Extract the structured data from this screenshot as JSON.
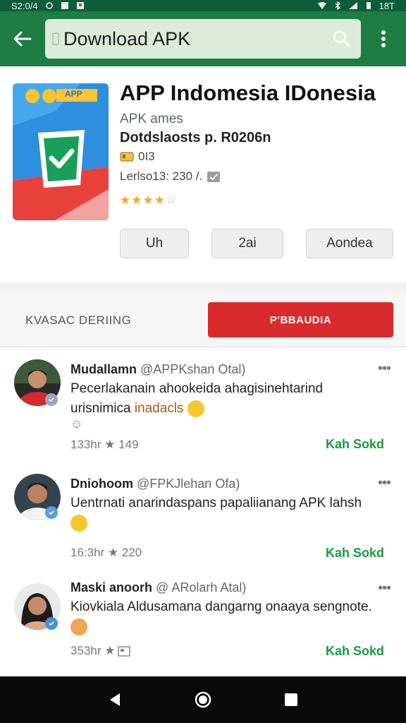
{
  "status_bar": {
    "time": "S2:0/4",
    "battery_text": "18T"
  },
  "search": {
    "placeholder": "Download APK"
  },
  "app": {
    "title": "APP Indomesia IDonesia",
    "category": "APK ames",
    "developer": "Dotdslaosts p. R0206n",
    "size": "0I3",
    "info": "Lerlso13: 230 /.",
    "rating_stars": 4,
    "rating_max": 5,
    "icon_badge": "APP",
    "buttons": [
      "Uh",
      "2ai",
      "Aondea"
    ]
  },
  "action_row": {
    "left_label": "KVASAC DERIING",
    "button_label": "P'BBAUDIA"
  },
  "reviews": [
    {
      "name": "Mudallamn",
      "handle": "@APPKshan Otal)",
      "text_main": "Pecerlakanain ahookeida ahagisinehtarind urisnimica ",
      "text_highlight": "inadacls",
      "meta": "133hr ★ 149",
      "action": "Kah Sokd",
      "sub": "☺"
    },
    {
      "name": "Dniohoom",
      "handle": "@FPKJlehan Ofa)",
      "text_main": "Uentrnati anarindaspans papaliianang APK lahsh",
      "text_highlight": "",
      "meta": "16:3hr ★ 220",
      "action": "Kah Sokd",
      "sub": ""
    },
    {
      "name": "Maski anoorh",
      "handle": "@ ARolarh Atal)",
      "text_main": "Kiovkiala Aldusamana dangarng onaaya sengnote.",
      "text_highlight": "",
      "meta": "353hr ★",
      "action": "Kah Sokd",
      "sub": ""
    }
  ],
  "colors": {
    "app_bar": "#1e7d45",
    "status_bar": "#0d5c3a",
    "accent_red": "#d92b2b",
    "review_action": "#1b9a42",
    "star": "#f5a623"
  }
}
